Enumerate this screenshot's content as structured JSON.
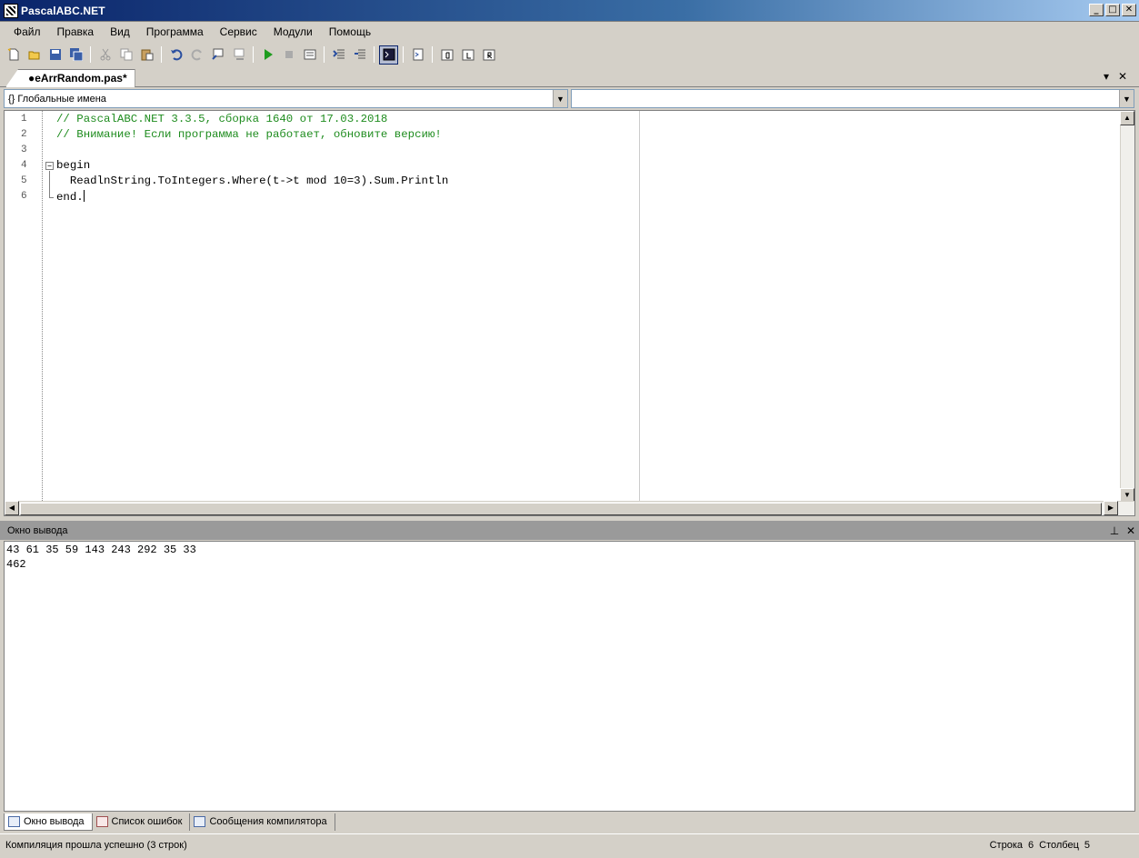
{
  "window": {
    "title": "PascalABC.NET",
    "buttons": [
      "_",
      "□",
      "✕"
    ]
  },
  "menu": [
    "Файл",
    "Правка",
    "Вид",
    "Программа",
    "Сервис",
    "Модули",
    "Помощь"
  ],
  "toolbar": {
    "icons": [
      "new-file-icon",
      "open-folder-icon",
      "save-icon",
      "save-all-icon",
      "cut-icon",
      "copy-icon",
      "paste-icon",
      "undo-icon",
      "redo-icon",
      "find-icon",
      "replace-icon",
      "run-icon",
      "stop-icon",
      "build-icon",
      "step-over-icon",
      "step-into-icon",
      "output-window-icon",
      "format-code-icon",
      "debug-d-icon",
      "debug-l-icon",
      "debug-r-icon"
    ]
  },
  "tab": {
    "label": "●eArrRandom.pas*",
    "controls": [
      "▾",
      "✕"
    ]
  },
  "scope": {
    "left": "{} Глобальные имена",
    "right": ""
  },
  "editor": {
    "line_numbers": [
      "1",
      "2",
      "3",
      "4",
      "5",
      "6"
    ],
    "lines": [
      "// PascalABC.NET 3.3.5, сборка 1640 от 17.03.2018",
      "// Внимание! Если программа не работает, обновите версию!",
      "",
      "begin",
      "  ReadlnString.ToIntegers.Where(t->t mod 10=3).Sum.Println",
      "end."
    ]
  },
  "output": {
    "title": "Окно вывода",
    "lines": [
      "43 61 35 59 143 243 292 35 33",
      "462"
    ]
  },
  "bottom_tabs": [
    "Окно вывода",
    "Список ошибок",
    "Сообщения компилятора"
  ],
  "status": {
    "message": "Компиляция прошла успешно (3 строк)",
    "row_label": "Строка",
    "row": "6",
    "col_label": "Столбец",
    "col": "5"
  }
}
